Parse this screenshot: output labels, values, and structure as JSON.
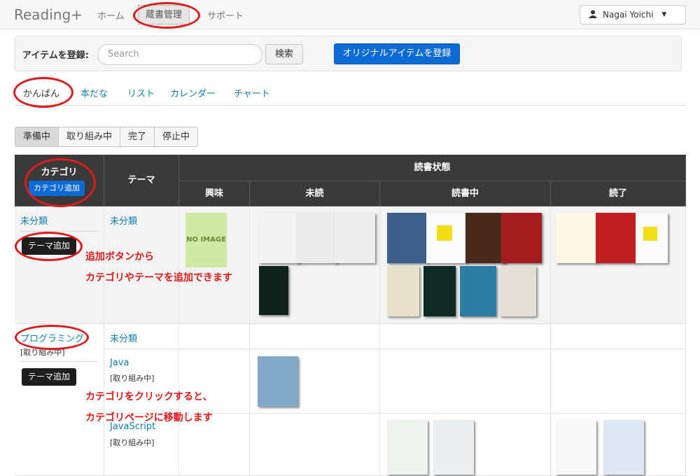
{
  "navbar": {
    "brand": "Reading+",
    "links": [
      "ホーム",
      "蔵書管理",
      "サポート"
    ],
    "user": "Nagai Yoichi"
  },
  "register": {
    "label": "アイテムを登録:",
    "placeholder": "Search",
    "search_btn": "検索",
    "original_btn": "オリジナルアイテムを登録"
  },
  "tabs": [
    "かんばん",
    "本だな",
    "リスト",
    "カレンダー",
    "チャート"
  ],
  "statuses": [
    "準備中",
    "取り組み中",
    "完了",
    "停止中"
  ],
  "table": {
    "category_header": "カテゴリ",
    "add_category": "カテゴリ追加",
    "theme_header": "テーマ",
    "status_header": "読書状態",
    "cols": [
      "興味",
      "未読",
      "読書中",
      "読了"
    ],
    "rows": [
      {
        "category": "未分類",
        "theme": "未分類",
        "add_theme": "テーマ追加"
      },
      {
        "category": "プログラミング",
        "category_status": "[取り組み中]",
        "themes": [
          {
            "name": "未分類",
            "status": ""
          },
          {
            "name": "Java",
            "status": "[取り組み中]"
          },
          {
            "name": "JavaScript",
            "status": "[取り組み中]"
          }
        ],
        "add_theme": "テーマ追加"
      }
    ],
    "no_image": "NO IMAGE"
  },
  "annotations": [
    "追加ボタンから",
    "カテゴリやテーマを追加できます",
    "カテゴリをクリックすると、",
    "カテゴリページに移動します"
  ],
  "colors": {
    "link": "#0d7fb0",
    "primary": "#0d6bd6",
    "annotation": "#e01a1a",
    "header": "#3a3a3a"
  }
}
